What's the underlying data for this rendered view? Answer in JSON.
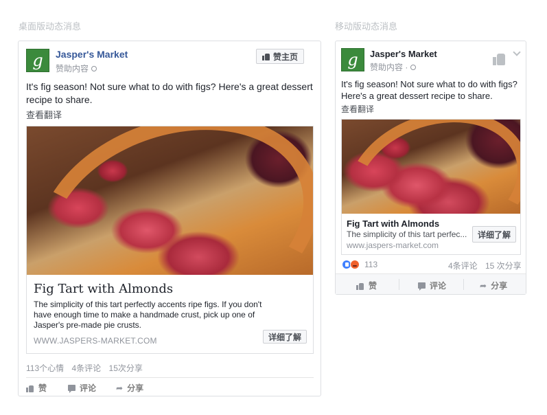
{
  "desktop_section": {
    "title": "桌面版动态消息"
  },
  "mobile_section": {
    "title": "移动版动态消息"
  },
  "post": {
    "page_name": "Jasper's Market",
    "sponsored": "赞助内容",
    "sponsored_mobile": "赞助内容 ·",
    "text": "It's fig season! Not sure what to do with figs? Here's a great dessert recipe to share.",
    "translate": "查看翻译",
    "like_page_button": "赞主页",
    "avatar_letter": "g",
    "link_title": "Fig Tart with Almonds",
    "link_desc_desktop": "The simplicity of this tart perfectly accents ripe figs. If you don't have enough time to make a handmade crust, pick up one of Jasper's pre-made pie crusts.",
    "link_desc_mobile": "The simplicity of this tart perfec...",
    "link_url_desktop": "WWW.JASPERS-MARKET.COM",
    "link_url_mobile": "www.jaspers-market.com",
    "learn_more": "详细了解"
  },
  "desktop_stats": {
    "reactions": "113个心情",
    "comments": "4条评论",
    "shares": "15次分享"
  },
  "mobile_stats": {
    "reactions": "113",
    "comments": "4条评论",
    "shares": "15 次分享"
  },
  "actions": {
    "like": "赞",
    "comment": "评论",
    "share": "分享"
  },
  "colors": {
    "brand_link": "#365899",
    "avatar_green": "#3b8a3c",
    "like_blue": "#4080ff",
    "angry_orange": "#f0612c"
  },
  "icons": [
    "thumbs-up-icon",
    "globe-icon",
    "comment-icon",
    "share-icon",
    "chevron-down-icon",
    "like-reaction-icon",
    "angry-reaction-icon"
  ]
}
